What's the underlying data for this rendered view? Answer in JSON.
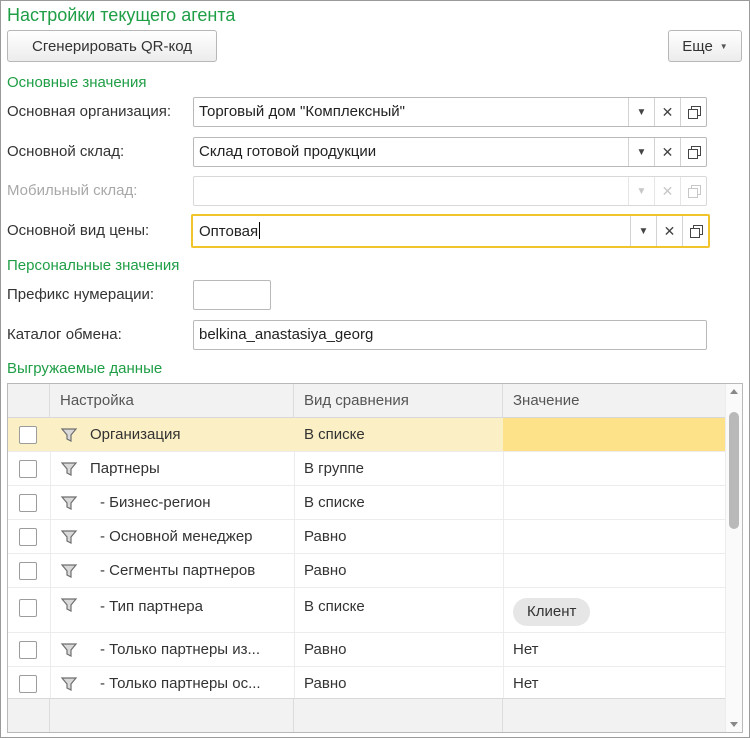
{
  "window": {
    "title": "Настройки текущего агента"
  },
  "toolbar": {
    "qr_label": "Сгенерировать QR-код",
    "more_label": "Еще"
  },
  "sections": {
    "main": "Основные значения",
    "personal": "Персональные значения",
    "exported": "Выгружаемые данные"
  },
  "fields": {
    "organization": {
      "label": "Основная организация:",
      "value": "Торговый дом \"Комплексный\""
    },
    "warehouse": {
      "label": "Основной склад:",
      "value": "Склад готовой продукции"
    },
    "mobile_warehouse": {
      "label": "Мобильный склад:",
      "value": ""
    },
    "price_type": {
      "label": "Основной вид цены:",
      "value": "Оптовая"
    },
    "prefix": {
      "label": "Префикс нумерации:",
      "value": ""
    },
    "exchange_catalog": {
      "label": "Каталог обмена:",
      "value": "belkina_anastasiya_georg"
    }
  },
  "grid": {
    "columns": [
      "Настройка",
      "Вид сравнения",
      "Значение"
    ],
    "rows": [
      {
        "name": "Организация",
        "cmp": "В списке",
        "value": ""
      },
      {
        "name": "Партнеры",
        "cmp": "В группе",
        "value": ""
      },
      {
        "name": "- Бизнес-регион",
        "cmp": "В списке",
        "value": ""
      },
      {
        "name": "- Основной менеджер",
        "cmp": "Равно",
        "value": ""
      },
      {
        "name": "- Сегменты партнеров",
        "cmp": "Равно",
        "value": ""
      },
      {
        "name": "- Тип партнера",
        "cmp": "В списке",
        "value": "Клиент"
      },
      {
        "name": "- Только партнеры из...",
        "cmp": "Равно",
        "value": "Нет"
      },
      {
        "name": "- Только партнеры ос...",
        "cmp": "Равно",
        "value": "Нет"
      }
    ]
  },
  "colors": {
    "accent_green": "#1f9e46",
    "focus_yellow": "#f2c42b",
    "selection": "#fbf0c5"
  }
}
